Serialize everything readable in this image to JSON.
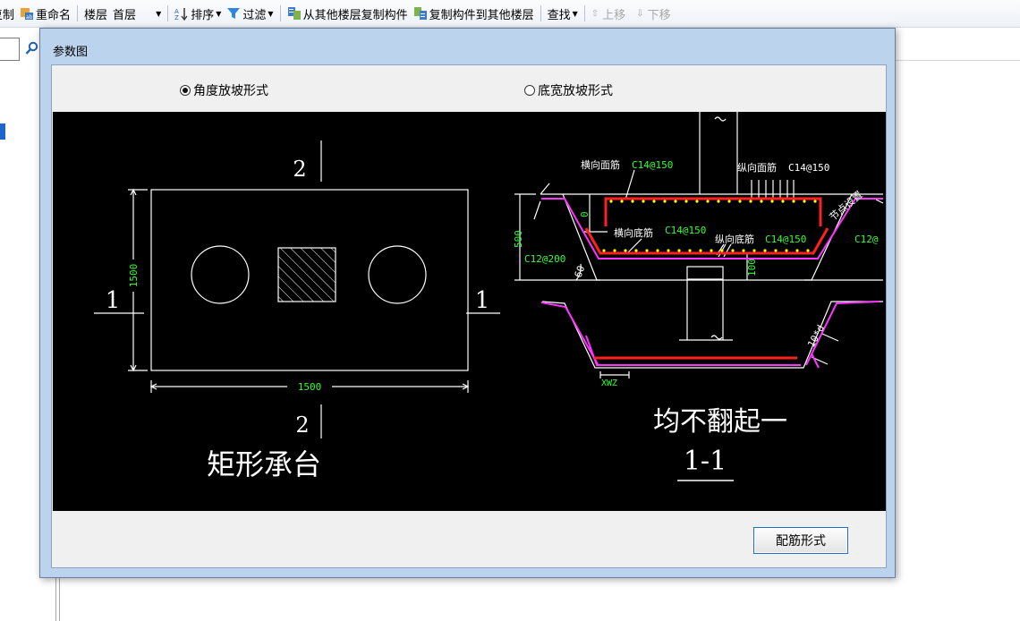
{
  "toolbar": {
    "copy_label": "复制",
    "rename_label": "重命名",
    "floor_label": "楼层",
    "floor_value": "首层",
    "sort_label": "排序",
    "filter_label": "过滤",
    "copy_from_other_floors": "从其他楼层复制构件",
    "copy_to_other_floors": "复制构件到其他楼层",
    "find_label": "查找",
    "move_up_label": "上移",
    "move_down_label": "下移"
  },
  "dialog": {
    "title": "参数图",
    "radio_angle": "角度放坡形式",
    "radio_angle_selected": true,
    "radio_width": "底宽放坡形式",
    "radio_width_selected": false,
    "rebar_button": "配筋形式"
  },
  "drawing": {
    "plan_title": "矩形承台",
    "plan_dim_vertical": "1500",
    "plan_dim_horizontal": "1500",
    "section_mark_top": "2",
    "section_mark_bottom": "2",
    "section_mark_left": "1",
    "section_mark_right": "1",
    "section_title_note": "均不翻起一",
    "section_title": "1-1",
    "label_transverse_top": "横向面筋",
    "label_transverse_top_spec": "C14@150",
    "label_longitudinal_top": "纵向面筋",
    "label_longitudinal_top_spec": "C14@150",
    "label_transverse_bottom": "横向底筋",
    "label_transverse_bottom_spec": "C14@150",
    "label_longitudinal_bottom": "纵向底筋",
    "label_longitudinal_bottom_spec": "C14@150",
    "label_side_spec": "C12@200",
    "label_side_spec_right": "C12@",
    "label_height": "500",
    "label_zero": "0",
    "label_cover": "100",
    "label_angle": "60",
    "label_anchor": "10*d",
    "label_xwz": "XWZ",
    "label_note_diag": "节点设置"
  },
  "colors": {
    "rebar_red": "#ff2020",
    "stirrup_magenta": "#ff33ff",
    "dim_green": "#33ff33",
    "cad_white": "#ffffff",
    "dot_yellow": "#ffff00"
  }
}
